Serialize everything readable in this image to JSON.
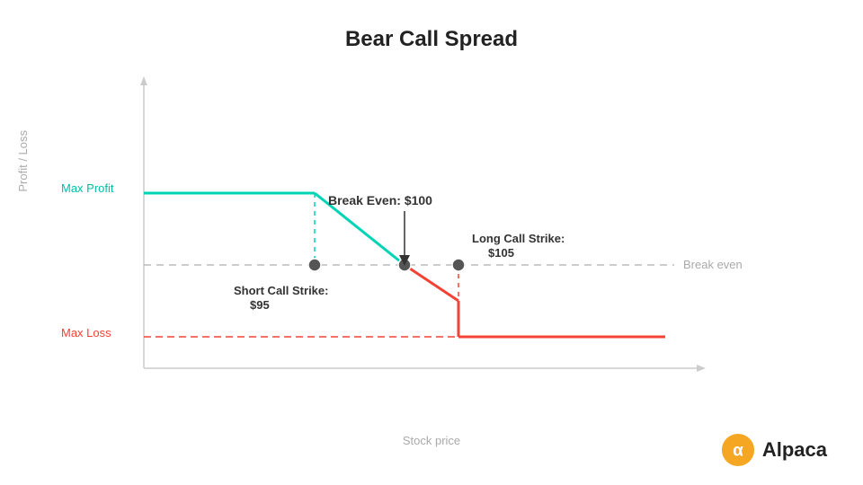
{
  "title": "Bear Call Spread",
  "chart": {
    "yAxisLabel": "Profit / Loss",
    "xAxisLabel": "Stock price",
    "maxProfitLabel": "Max Profit",
    "maxLossLabel": "Max Loss",
    "breakEvenLineLabel": "Break even",
    "annotations": [
      {
        "id": "break-even",
        "label": "Break Even: $100"
      },
      {
        "id": "short-call",
        "label": "Short Call Strike:\n$95"
      },
      {
        "id": "long-call",
        "label": "Long Call Strike:\n$105"
      }
    ]
  },
  "logo": {
    "name": "Alpaca",
    "iconColor": "#F5A623"
  }
}
